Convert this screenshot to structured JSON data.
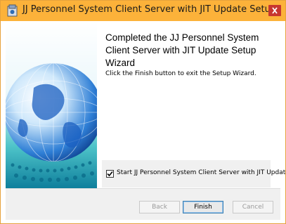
{
  "window": {
    "title": "JJ Personnel System Client Server with JIT Update Setup",
    "close_icon": "close-icon",
    "app_icon": "installer-icon"
  },
  "main": {
    "heading": "Completed the JJ Personnel System Client Server with JIT Update Setup Wizard",
    "body": "Click the Finish button to exit the Setup Wizard.",
    "launch_checkbox": {
      "label": "Start JJ Personnel System Client Server with JIT Update",
      "checked": true
    }
  },
  "buttons": {
    "back": "Back",
    "finish": "Finish",
    "cancel": "Cancel"
  },
  "colors": {
    "titlebar": "#fcb23a",
    "close": "#c7372f",
    "accent": "#3c7fb1"
  }
}
